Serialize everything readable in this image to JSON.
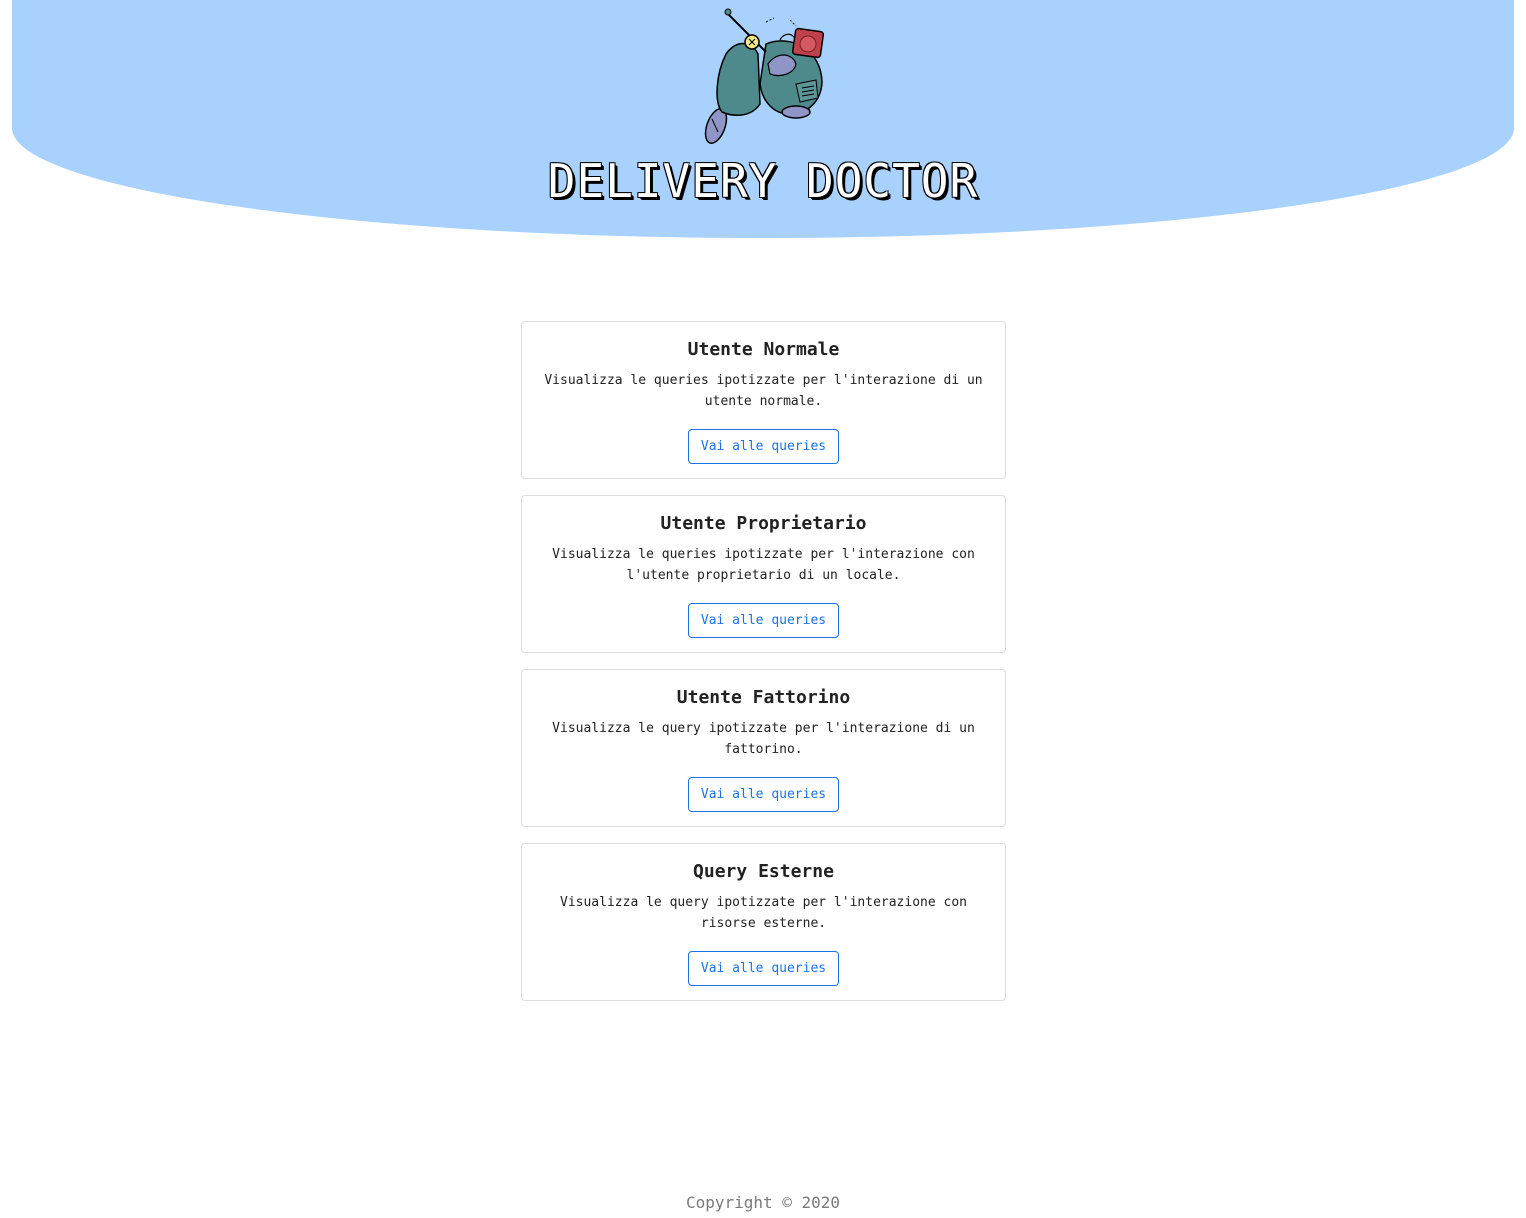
{
  "header": {
    "logo_icon": "delivery-scooter-icon",
    "title": "DELIVERY DOCTOR"
  },
  "cards": [
    {
      "title": "Utente Normale",
      "text": "Visualizza le queries ipotizzate per l'interazione di un utente normale.",
      "button": "Vai alle queries"
    },
    {
      "title": "Utente Proprietario",
      "text": "Visualizza le queries ipotizzate per l'interazione con l'utente proprietario di un locale.",
      "button": "Vai alle queries"
    },
    {
      "title": "Utente Fattorino",
      "text": "Visualizza le query ipotizzate per l'interazione di un fattorino.",
      "button": "Vai alle queries"
    },
    {
      "title": "Query Esterne",
      "text": "Visualizza le query ipotizzate per l'interazione con risorse esterne.",
      "button": "Vai alle queries"
    }
  ],
  "footer": {
    "copyright": "Copyright © 2020"
  },
  "colors": {
    "header_bg": "#a9d1fd",
    "button_accent": "#1a73e8",
    "scooter_body": "#4e8a8b",
    "delivery_box": "#c0414b"
  }
}
